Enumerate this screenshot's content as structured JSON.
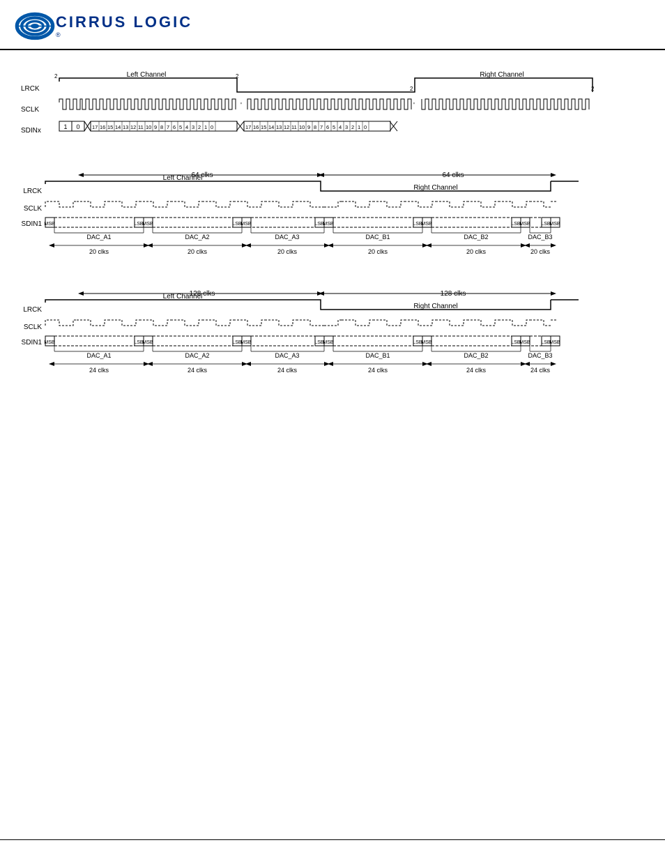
{
  "header": {
    "company": "CIRRUS LOGIC",
    "trademark": "®"
  },
  "diagram1": {
    "signals": [
      "LRCK",
      "SCLK",
      "SDINx"
    ],
    "left_channel": "Left Channel",
    "right_channel": "Right Channel",
    "bits": [
      1,
      0,
      17,
      16,
      15,
      14,
      13,
      12,
      11,
      10,
      9,
      8,
      7,
      6,
      5,
      4,
      3,
      2,
      1,
      0
    ]
  },
  "diagram2": {
    "title_left": "64 clks",
    "title_right": "64 clks",
    "signals": [
      "LRCK",
      "SCLK",
      "SDIN1"
    ],
    "left_channel": "Left Channel",
    "right_channel": "Right Channel",
    "left_dacs": [
      "DAC_A1",
      "DAC_A2",
      "DAC_A3"
    ],
    "right_dacs": [
      "DAC_B1",
      "DAC_B2",
      "DAC_B3"
    ],
    "left_clks": [
      "20 clks",
      "20 clks",
      "20 clks"
    ],
    "right_clks": [
      "20 clks",
      "20 clks",
      "20 clks"
    ]
  },
  "diagram3": {
    "title_left": "128 clks",
    "title_right": "128 clks",
    "signals": [
      "LRCK",
      "SCLK",
      "SDIN1"
    ],
    "left_channel": "Left Channel",
    "right_channel": "Right Channel",
    "left_dacs": [
      "DAC_A1",
      "DAC_A2",
      "DAC_A3"
    ],
    "right_dacs": [
      "DAC_B1",
      "DAC_B2",
      "DAC_B3"
    ],
    "left_clks": [
      "24 clks",
      "24 clks",
      "24 clks"
    ],
    "right_clks": [
      "24 clks",
      "24 clks",
      "24 clks"
    ]
  }
}
